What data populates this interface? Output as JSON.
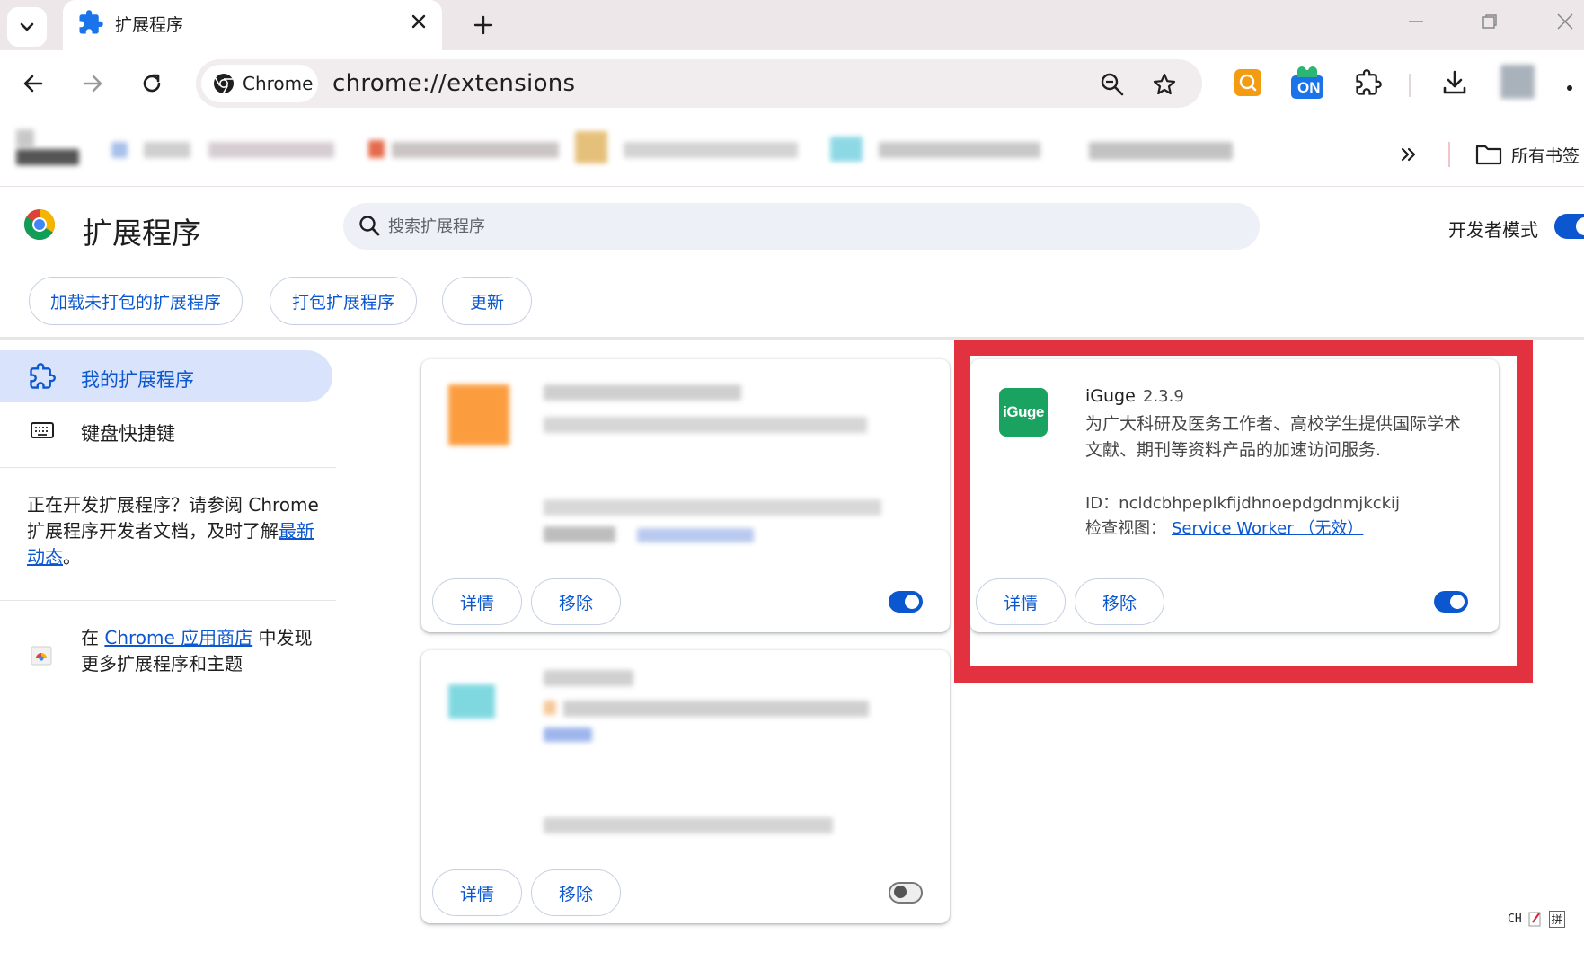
{
  "tab": {
    "title": "扩展程序",
    "close_icon": "close-icon"
  },
  "address_bar": {
    "chip_label": "Chrome",
    "url": "chrome://extensions"
  },
  "toolbar_extensions": {
    "on_badge": "ON"
  },
  "bookmarks_bar": {
    "all_bookmarks_label": "所有书签"
  },
  "extensions_page": {
    "title": "扩展程序",
    "search_placeholder": "搜索扩展程序",
    "developer_mode_label": "开发者模式",
    "developer_mode_enabled": true,
    "actions": {
      "load_unpacked": "加载未打包的扩展程序",
      "pack": "打包扩展程序",
      "update": "更新"
    }
  },
  "sidebar": {
    "my_extensions": "我的扩展程序",
    "keyboard_shortcuts": "键盘快捷键",
    "dev_promo_text": "正在开发扩展程序？请参阅 Chrome 扩展程序开发者文档，及时了解",
    "dev_promo_link": "最新动态",
    "dev_promo_end": "。",
    "store_prefix": "在 ",
    "store_link": "Chrome 应用商店",
    "store_suffix": " 中发现更多扩展程序和主题"
  },
  "cards": [
    {
      "details_label": "详情",
      "remove_label": "移除",
      "enabled": true
    },
    {
      "logo_text": "iGuge",
      "name": "iGuge",
      "version": "2.3.9",
      "description": "为广大科研及医务工作者、高校学生提供国际学术文献、期刊等资料产品的加速访问服务.",
      "id_label": "ID：",
      "id_value": "ncldcbhpeplkfijdhnoepdgdnmjkckij",
      "inspect_label": "检查视图：",
      "inspect_link": "Service Worker （无效）",
      "details_label": "详情",
      "remove_label": "移除",
      "enabled": true
    },
    {
      "details_label": "详情",
      "remove_label": "移除",
      "enabled": false
    }
  ],
  "ime": {
    "lang": "CH",
    "mode": "拼"
  },
  "colors": {
    "accent": "#0b57d0",
    "highlight": "#e2323f",
    "iguge": "#1aa260"
  }
}
